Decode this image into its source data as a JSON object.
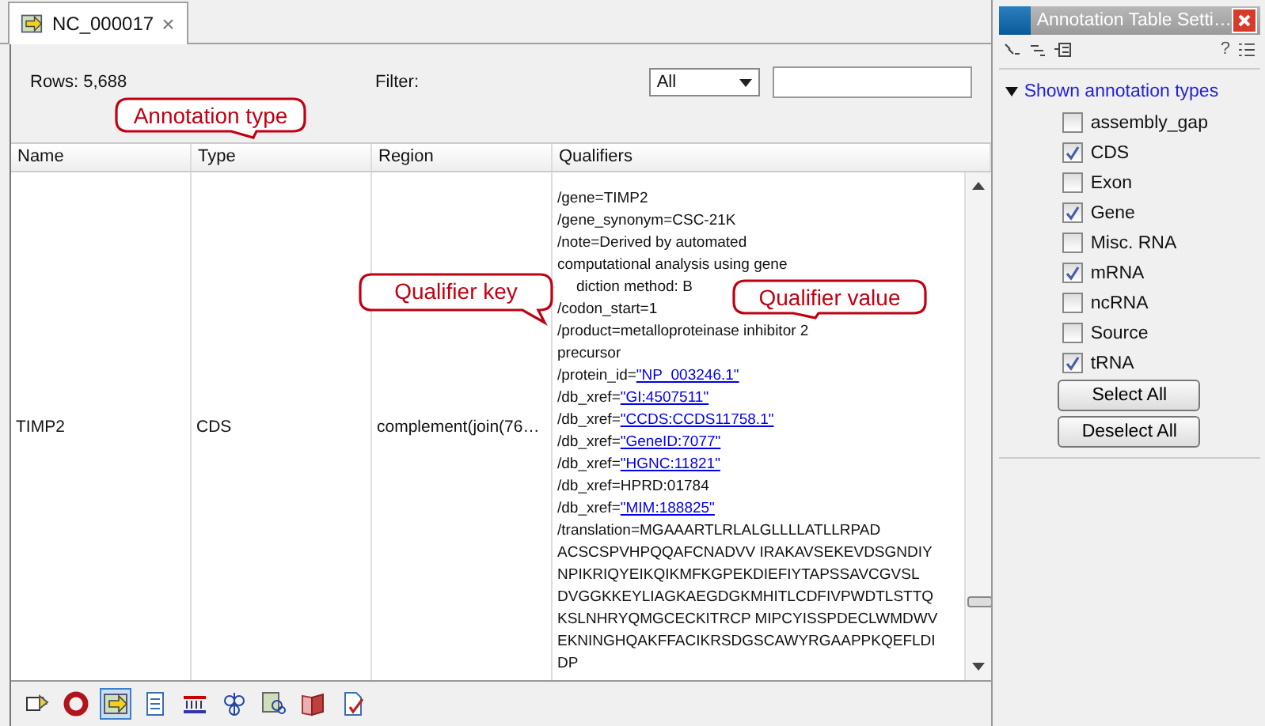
{
  "tab": {
    "title": "NC_000017",
    "close": "×"
  },
  "toolbar": {
    "rows": "Rows: 5,688",
    "filter_label": "Filter:",
    "filter_select": "All"
  },
  "table": {
    "columns": [
      "Name",
      "Type",
      "Region",
      "Qualifiers"
    ],
    "row": {
      "name": "TIMP2",
      "type": "CDS",
      "region": "complement(join(76…",
      "qualifiers": [
        {
          "kind": "text",
          "text": "/gene=TIMP2"
        },
        {
          "kind": "text",
          "text": "/gene_synonym=CSC-21K"
        },
        {
          "kind": "text",
          "text": "/note=Derived by automated"
        },
        {
          "kind": "text",
          "text": "computational analysis using gene"
        },
        {
          "kind": "partial",
          "text": "diction method: B"
        },
        {
          "kind": "text",
          "text": "/codon_start=1"
        },
        {
          "kind": "text",
          "text": "/product=metalloproteinase inhibitor 2"
        },
        {
          "kind": "text",
          "text": "precursor"
        },
        {
          "kind": "link",
          "text": "/protein_id=",
          "link": "\"NP_003246.1\""
        },
        {
          "kind": "link",
          "text": "/db_xref=",
          "link": "\"GI:4507511\""
        },
        {
          "kind": "link",
          "text": "/db_xref=",
          "link": "\"CCDS:CCDS11758.1\""
        },
        {
          "kind": "link",
          "text": "/db_xref=",
          "link": "\"GeneID:7077\""
        },
        {
          "kind": "link",
          "text": "/db_xref=",
          "link": "\"HGNC:11821\""
        },
        {
          "kind": "text",
          "text": "/db_xref=HPRD:01784"
        },
        {
          "kind": "link",
          "text": "/db_xref=",
          "link": "\"MIM:188825\""
        },
        {
          "kind": "text",
          "text": "/translation=MGAAARTLRLALGLLLLATLLRPAD"
        },
        {
          "kind": "text",
          "text": "ACSCSPVHPQQAFCNADVV IRAKAVSEKEVDSGNDIY"
        },
        {
          "kind": "text",
          "text": "NPIKRIQYEIKQIKMFKGPEKDIEFIYTAPSSAVCGVSL"
        },
        {
          "kind": "text",
          "text": "DVGGKKEYLIAGKAEGDGKMHITLCDFIVPWDTLSTTQ"
        },
        {
          "kind": "text",
          "text": "KSLNHRYQMGCECKITRCP MIPCYISSPDECLWMDWV"
        },
        {
          "kind": "text",
          "text": "EKNINGHQAKFFACIKRSDGSCAWYRGAAPPKQEFLDI"
        },
        {
          "kind": "text",
          "text": "DP"
        }
      ]
    }
  },
  "callouts": [
    {
      "text": "Annotation type",
      "kind": "annotation"
    },
    {
      "text": "Qualifier key",
      "kind": "key"
    },
    {
      "text": "Qualifier value",
      "kind": "value"
    }
  ],
  "bottom_toolbar": [
    {
      "selected": false
    },
    {
      "selected": false
    },
    {
      "selected": true
    },
    {
      "selected": false
    },
    {
      "selected": false
    },
    {
      "selected": false
    },
    {
      "selected": false
    },
    {
      "selected": false
    },
    {
      "selected": false
    }
  ],
  "settings": {
    "title": "Annotation Table Setti…",
    "help": "?",
    "section": "Shown annotation types",
    "expanded": true,
    "types": [
      {
        "label": "assembly_gap",
        "checked": false
      },
      {
        "label": "CDS",
        "checked": true
      },
      {
        "label": "Exon",
        "checked": false
      },
      {
        "label": "Gene",
        "checked": true
      },
      {
        "label": "Misc. RNA",
        "checked": false
      },
      {
        "label": "mRNA",
        "checked": true
      },
      {
        "label": "ncRNA",
        "checked": false
      },
      {
        "label": "Source",
        "checked": false
      },
      {
        "label": "tRNA",
        "checked": true
      }
    ],
    "buttons": [
      "Select All",
      "Deselect All"
    ]
  }
}
